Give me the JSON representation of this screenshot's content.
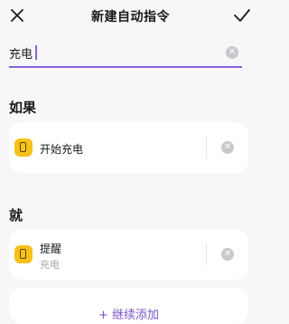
{
  "header": {
    "title": "新建自动指令",
    "close_icon": "close-icon",
    "confirm_icon": "check-icon"
  },
  "name_field": {
    "value": "充电",
    "accent_color": "#8a63d2"
  },
  "if_section": {
    "label": "如果",
    "condition": {
      "text": "开始充电",
      "icon": "battery-icon",
      "icon_color": "#f6c21a"
    }
  },
  "then_section": {
    "label": "就",
    "action": {
      "title": "提醒",
      "subtitle": "充电",
      "icon": "battery-icon",
      "icon_color": "#f6c21a"
    }
  },
  "add_more": {
    "label": "+ 继续添加"
  }
}
